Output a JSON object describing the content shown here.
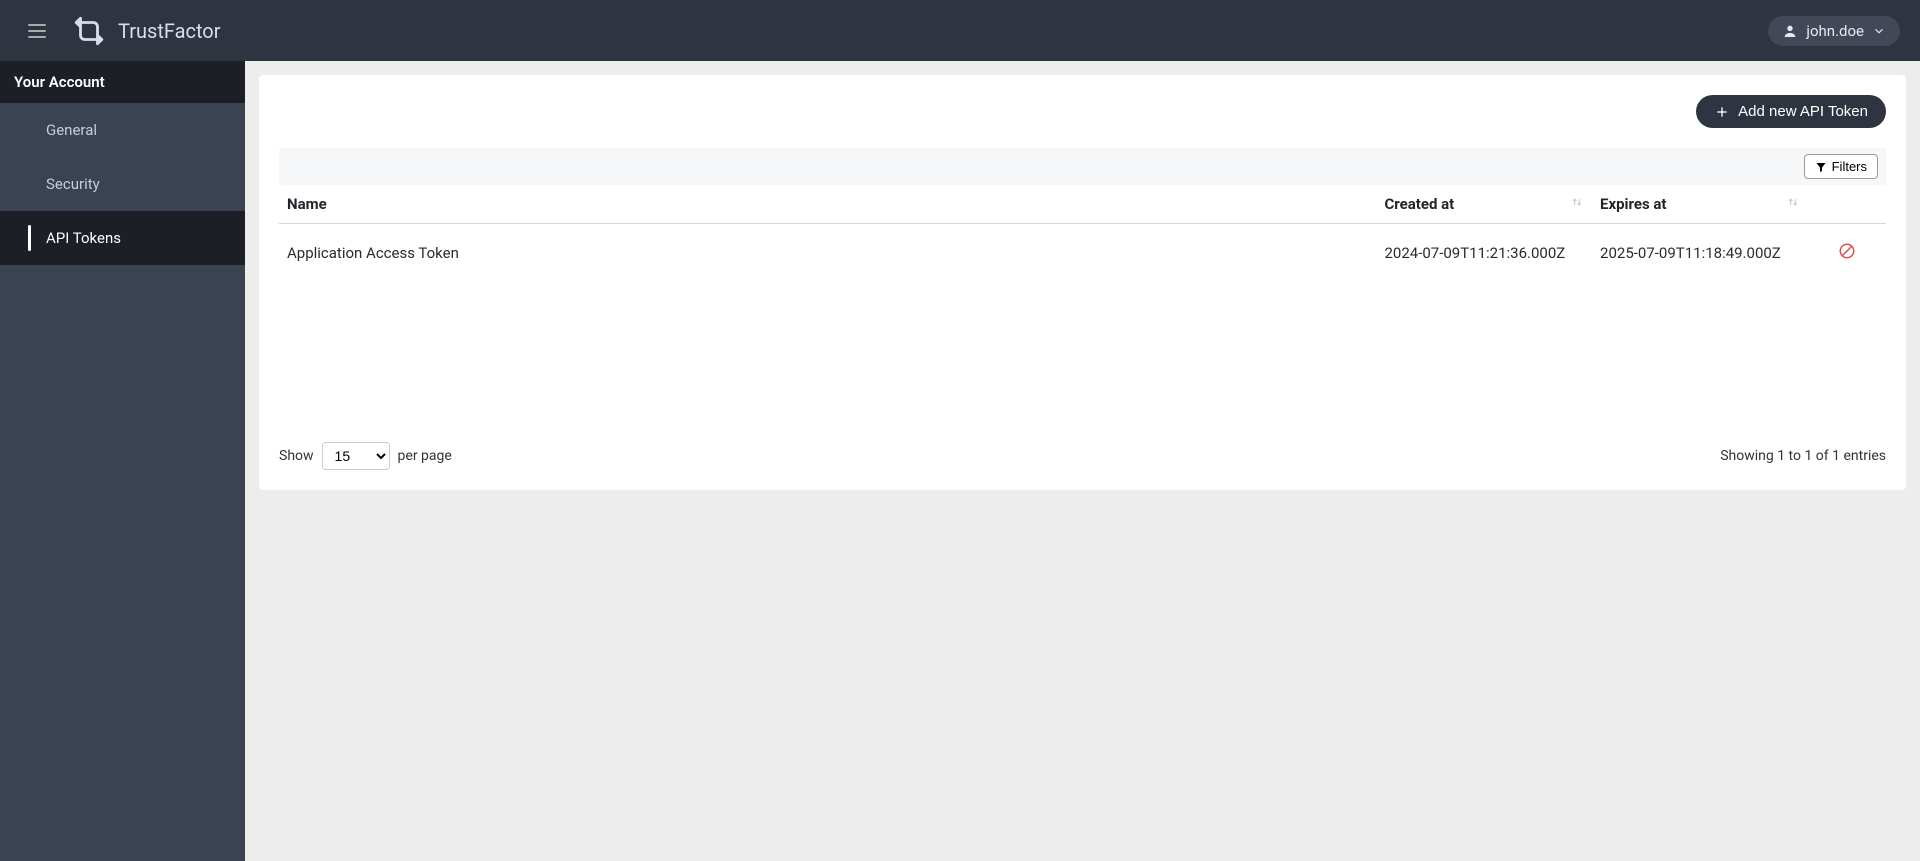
{
  "header": {
    "brand": "TrustFactor",
    "user": "john.doe"
  },
  "sidebar": {
    "title": "Your Account",
    "items": [
      {
        "label": "General",
        "active": false
      },
      {
        "label": "Security",
        "active": false
      },
      {
        "label": "API Tokens",
        "active": true
      }
    ]
  },
  "main": {
    "addButton": "Add new API Token",
    "filtersLabel": "Filters",
    "columns": {
      "name": "Name",
      "created": "Created at",
      "expires": "Expires at"
    },
    "rows": [
      {
        "name": "Application Access Token",
        "created": "2024-07-09T11:21:36.000Z",
        "expires": "2025-07-09T11:18:49.000Z"
      }
    ],
    "pagination": {
      "showLabel": "Show",
      "perPageValue": "15",
      "perPageLabel": "per page",
      "summary": "Showing 1 to 1 of 1 entries"
    }
  }
}
